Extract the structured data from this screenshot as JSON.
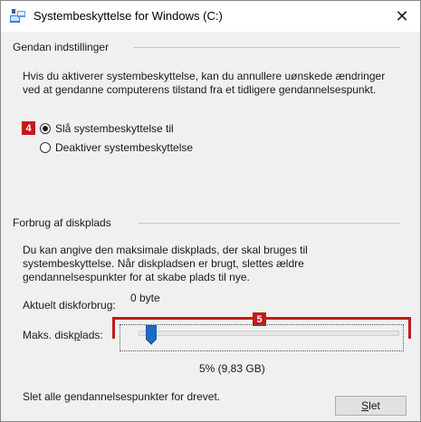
{
  "window": {
    "title": "Systembeskyttelse for Windows (C:)",
    "close_glyph": "✕"
  },
  "restore": {
    "heading": "Gendan indstillinger",
    "description": "Hvis du aktiverer systembeskyttelse, kan du annullere uønskede ændringer ved at gendanne computerens tilstand fra et tidligere gendannelsespunkt.",
    "options": [
      {
        "label": "Slå systembeskyttelse til",
        "checked": true
      },
      {
        "label": "Deaktiver systembeskyttelse",
        "checked": false
      }
    ],
    "badge": "4"
  },
  "disk": {
    "heading": "Forbrug af diskplads",
    "description": "Du kan angive den maksimale diskplads, der skal bruges til systembeskyttelse. Når diskpladsen er brugt, slettes ældre gendannelsespunkter for at skabe plads til nye.",
    "current_label": "Aktuelt diskforbrug:",
    "current_value": "0 byte",
    "max_label_pre": "Maks. disk",
    "max_label_underlined": "p",
    "max_label_post": "lads:",
    "slider_fraction": 0.05,
    "slider_value": "5% (9,83 GB)",
    "badge": "5"
  },
  "footer": {
    "text": "Slet alle gendannelsespunkter for drevet.",
    "button_underlined": "S",
    "button_rest": "let"
  },
  "colors": {
    "accent": "#1e6bc4",
    "badge": "#c41a1a"
  }
}
